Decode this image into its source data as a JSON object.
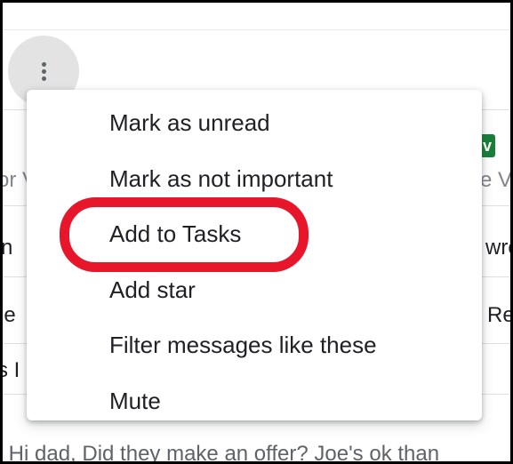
{
  "background": {
    "row_fragments": {
      "left_1": "or V",
      "right_1": "e Va",
      "left_2": "n",
      "right_2": "wro",
      "left_3": "le",
      "right_3": "Re",
      "left_4": "s I"
    },
    "badge_label": "v",
    "preview_text": "- Hi dad, Did they make an offer? Joe's ok than"
  },
  "menu": {
    "items": [
      "Mark as unread",
      "Mark as not important",
      "Add to Tasks",
      "Add star",
      "Filter messages like these",
      "Mute"
    ]
  },
  "colors": {
    "highlight": "#e8162a",
    "badge": "#188038",
    "menu_text": "#202124"
  }
}
